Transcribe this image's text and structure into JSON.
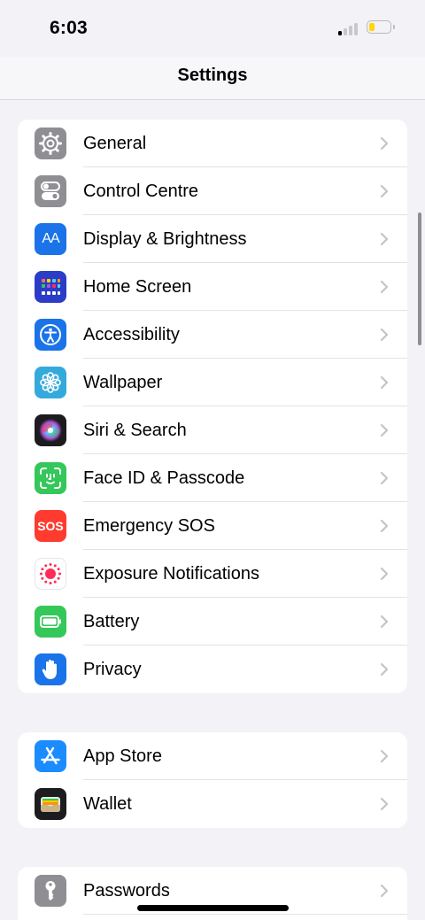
{
  "status_bar": {
    "time": "6:03",
    "battery_fraction": 0.22
  },
  "nav": {
    "title": "Settings"
  },
  "groups": [
    {
      "items": [
        {
          "label": "General",
          "icon": "gear-icon",
          "color": "#8e8e93"
        },
        {
          "label": "Control Centre",
          "icon": "toggle-icon",
          "color": "#8e8e93"
        },
        {
          "label": "Display & Brightness",
          "icon": "text-size-icon",
          "color": "#1a73e8",
          "glyph": "AA"
        },
        {
          "label": "Home Screen",
          "icon": "app-grid-icon",
          "color": "#2b3cc7"
        },
        {
          "label": "Accessibility",
          "icon": "accessibility-icon",
          "color": "#1a73e8"
        },
        {
          "label": "Wallpaper",
          "icon": "flower-icon",
          "color": "#34aadc"
        },
        {
          "label": "Siri & Search",
          "icon": "siri-icon",
          "color": "#1c1c1e"
        },
        {
          "label": "Face ID & Passcode",
          "icon": "face-id-icon",
          "color": "#34c759"
        },
        {
          "label": "Emergency SOS",
          "icon": "sos-icon",
          "color": "#ff3b30",
          "glyph": "SOS"
        },
        {
          "label": "Exposure Notifications",
          "icon": "exposure-icon",
          "color": "#ffffff"
        },
        {
          "label": "Battery",
          "icon": "battery-icon",
          "color": "#34c759"
        },
        {
          "label": "Privacy",
          "icon": "hand-icon",
          "color": "#1a73e8"
        }
      ]
    },
    {
      "items": [
        {
          "label": "App Store",
          "icon": "app-store-icon",
          "color": "#1a8cff"
        },
        {
          "label": "Wallet",
          "icon": "wallet-icon",
          "color": "#1c1c1e"
        }
      ]
    },
    {
      "items": [
        {
          "label": "Passwords",
          "icon": "key-icon",
          "color": "#8e8e93"
        }
      ]
    }
  ]
}
